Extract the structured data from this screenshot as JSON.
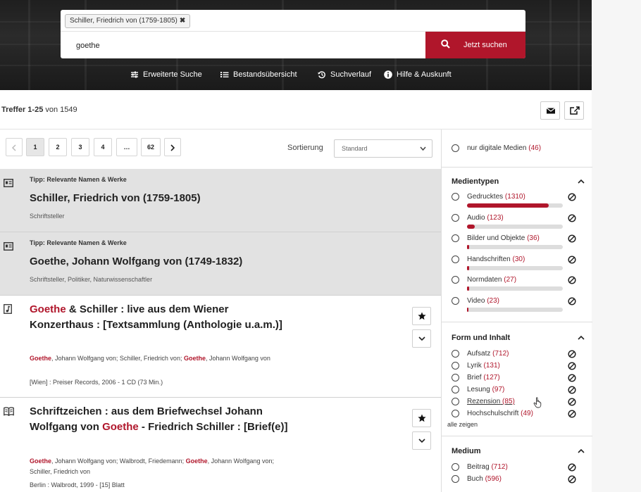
{
  "search": {
    "chip_label": "Schiller, Friedrich von (1759-1805)",
    "chip_remove": "✖",
    "query": "goethe",
    "button_label": "Jetzt suchen"
  },
  "nav": {
    "advanced": "Erweiterte Suche",
    "overview": "Bestandsübersicht",
    "history": "Suchverlauf",
    "help": "Hilfe & Auskunft"
  },
  "results": {
    "hits_prefix": "Treffer 1-25",
    "hits_suffix": "von 1549",
    "pages": [
      "1",
      "2",
      "3",
      "4",
      "…",
      "62"
    ],
    "sort_label": "Sortierung",
    "sort_value": "Standard",
    "tips": [
      {
        "label": "Tipp: Relevante Namen & Werke",
        "name": "Schiller, Friedrich von (1759-1805)",
        "sub": "Schriftsteller"
      },
      {
        "label": "Tipp: Relevante Namen & Werke",
        "name": "Goethe, Johann Wolfgang von (1749-1832)",
        "sub": "Schriftsteller, Politiker, Naturwissenschaftler"
      }
    ],
    "items": [
      {
        "title_red": "Goethe",
        "title_rest": "& Schiller : live aus dem Wiener Konzerthaus : [Textsammlung (Anthologie u.a.m.)]",
        "author_r1": "Goethe",
        "author_t1": ", Johann Wolfgang von; Schiller, Friedrich von; ",
        "author_r2": "Goethe",
        "author_t2": ", Johann Wolfgang von",
        "pub": "[Wien] : Preiser Records, 2006 - 1 CD (73 Min.)"
      },
      {
        "title_a": "Schriftzeichen : aus dem Briefwechsel Johann Wolfgang von",
        "title_red": "Goethe",
        "title_b": "- Friedrich Schiller : [Brief(e)]",
        "author_r1": "Goethe",
        "author_t1": ", Johann Wolfgang von; Walbrodt, Friedemann; ",
        "author_r2": "Goethe",
        "author_t2": ", Johann Wolfgang von; Schiller, Friedrich von",
        "pub": "Berlin : Walbrodt, 1999 - [15] Blatt"
      }
    ]
  },
  "filters": {
    "digital": {
      "label": "nur digitale Medien",
      "count": "(46)"
    },
    "medientypen": {
      "title": "Medientypen",
      "items": [
        {
          "label": "Gedrucktes",
          "count": "(1310)",
          "share": 0.85
        },
        {
          "label": "Audio",
          "count": "(123)",
          "share": 0.08
        },
        {
          "label": "Bilder und Objekte",
          "count": "(36)",
          "share": 0.025
        },
        {
          "label": "Handschriften",
          "count": "(30)",
          "share": 0.02
        },
        {
          "label": "Normdaten",
          "count": "(27)",
          "share": 0.02
        },
        {
          "label": "Video",
          "count": "(23)",
          "share": 0.015
        }
      ]
    },
    "form": {
      "title": "Form und Inhalt",
      "items": [
        {
          "label": "Aufsatz",
          "count": "(712)"
        },
        {
          "label": "Lyrik",
          "count": "(131)"
        },
        {
          "label": "Brief",
          "count": "(127)"
        },
        {
          "label": "Lesung",
          "count": "(97)"
        },
        {
          "label": "Rezension",
          "count": "(85)"
        },
        {
          "label": "Hochschulschrift",
          "count": "(49)"
        }
      ],
      "show_all": "alle zeigen"
    },
    "medium": {
      "title": "Medium",
      "items": [
        {
          "label": "Beitrag",
          "count": "(712)"
        },
        {
          "label": "Buch",
          "count": "(596)"
        }
      ]
    }
  },
  "colors": {
    "accent": "#b0162b",
    "hero": "#222222",
    "tip_bg": "#e2e2e2"
  }
}
